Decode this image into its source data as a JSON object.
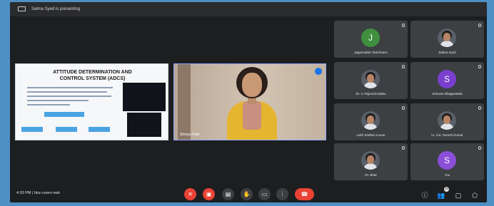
{
  "topbar": {
    "presenting_text": "Salma Syed is presenting"
  },
  "slide": {
    "title_line1": "ATTITUDE DETERMINATION AND",
    "title_line2": "CONTROL SYSTEM (ADCS)"
  },
  "speaker": {
    "name": "Shreya Patil"
  },
  "participants": [
    {
      "name": "Jagannatha Tantrimanc",
      "avatar_letter": "J",
      "avatar_color": "#3f8f3f",
      "type": "letter"
    },
    {
      "name": "Salma Syed",
      "avatar_letter": "",
      "avatar_color": "",
      "type": "photo"
    },
    {
      "name": "Dr. V. Rajendra Babu",
      "avatar_letter": "",
      "avatar_color": "",
      "type": "photo"
    },
    {
      "name": "Srinivas Bhagavatula",
      "avatar_letter": "S",
      "avatar_color": "#7b3fcf",
      "type": "letter"
    },
    {
      "name": "Lekh Sridhar Kumar",
      "avatar_letter": "",
      "avatar_color": "",
      "type": "photo"
    },
    {
      "name": "Lt. Col. Suresh Kumar",
      "avatar_letter": "",
      "avatar_color": "",
      "type": "photo"
    },
    {
      "name": "Dr. Bhat",
      "avatar_letter": "",
      "avatar_color": "",
      "type": "photo"
    },
    {
      "name": "You",
      "avatar_letter": "S",
      "avatar_color": "#8a4fd6",
      "type": "letter"
    }
  ],
  "bottombar": {
    "time_and_code": "4:03 PM  |  hbz-czwm-vwk",
    "people_count": "10"
  },
  "controls": {
    "mic_icon": "mic-off-icon",
    "camera_icon": "camera-off-icon",
    "captions_icon": "captions-icon",
    "raise_hand_icon": "raise-hand-icon",
    "present_icon": "present-icon",
    "more_icon": "more-icon",
    "end_call_icon": "end-call-icon"
  },
  "colors": {
    "danger": "#ea4335",
    "accent": "#1a73e8",
    "surface": "#1d1e20",
    "tile": "#3c4043"
  }
}
